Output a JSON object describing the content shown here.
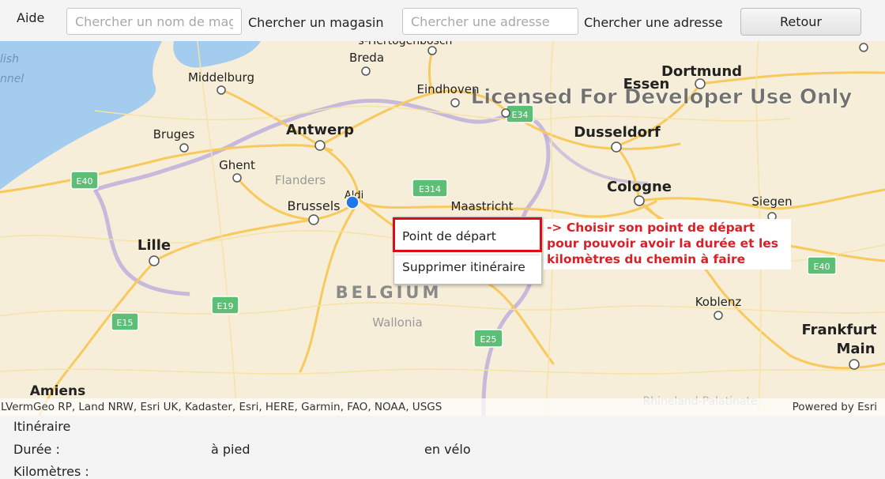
{
  "toolbar": {
    "help_label": "Aide",
    "store_search": {
      "placeholder": "Chercher un nom de magasin",
      "value": ""
    },
    "store_search_label": "Chercher un magasin",
    "address_search": {
      "placeholder": "Chercher une adresse",
      "value": ""
    },
    "address_search_label": "Chercher une adresse",
    "back_label": "Retour"
  },
  "map": {
    "watermark": "Licensed For Developer Use Only",
    "country_label": "BELGIUM",
    "region_labels": [
      "Flanders",
      "Wallonia",
      "Rhineland-Palatinate"
    ],
    "sea_labels": [
      "lish",
      "nnel"
    ],
    "cities": [
      {
        "name": "Breda"
      },
      {
        "name": "Middelburg"
      },
      {
        "name": "Eindhoven"
      },
      {
        "name": "Essen"
      },
      {
        "name": "Dortmund"
      },
      {
        "name": "Bruges"
      },
      {
        "name": "Antwerp"
      },
      {
        "name": "Dusseldorf"
      },
      {
        "name": "Ghent"
      },
      {
        "name": "Cologne"
      },
      {
        "name": "Brussels"
      },
      {
        "name": "Maastricht"
      },
      {
        "name": "Siegen"
      },
      {
        "name": "Lille"
      },
      {
        "name": "Koblenz"
      },
      {
        "name": "Frankfurt"
      },
      {
        "name": "Main"
      },
      {
        "name": "Amiens"
      },
      {
        "name": "'s-Hertogenbosch"
      }
    ],
    "road_shields": [
      "E40",
      "E314",
      "E34",
      "E19",
      "E15",
      "E25",
      "E40"
    ],
    "store_marker": {
      "label": "Aldi",
      "color": "#1f78e8"
    },
    "attribution_left": "LVermGeo RP, Land NRW, Esri UK, Kadaster, Esri, HERE, Garmin, FAO, NOAA, USGS",
    "attribution_right": "Powered by Esri"
  },
  "context_menu": {
    "items": [
      "Point de départ",
      "Supprimer itinéraire"
    ],
    "highlight_color": "#e10b17"
  },
  "annotation": {
    "text": "-> Choisir son point de départ pour pouvoir avoir la durée et les kilomètres du chemin à faire",
    "color": "#dc1f26"
  },
  "route_panel": {
    "title": "Itinéraire",
    "duration_label": "Durée :",
    "walking_label": "à pied",
    "cycling_label": "en vélo",
    "distance_label": "Kilomètres :"
  }
}
